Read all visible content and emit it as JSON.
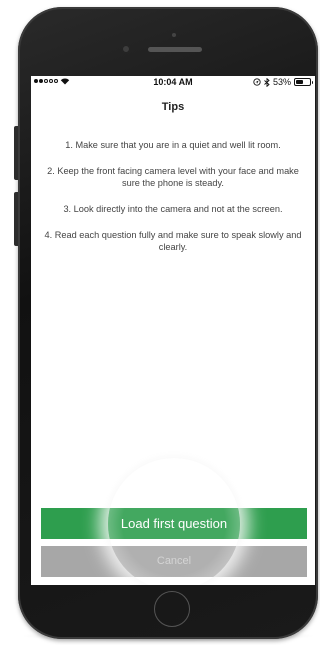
{
  "status_bar": {
    "time": "10:04 AM",
    "battery_percent": "53%",
    "battery_level": 0.53,
    "signal_bars": 2,
    "icons": [
      "signal-dots-icon",
      "wifi-icon",
      "location-icon",
      "bluetooth-icon",
      "battery-icon"
    ]
  },
  "page": {
    "title": "Tips"
  },
  "tips": [
    "1. Make sure that you are in a quiet and well lit room.",
    "2. Keep the front facing camera level with your face and make sure the phone is steady.",
    "3. Look directly into the camera and not at the screen.",
    "4. Read each question fully and make sure to speak slowly and clearly."
  ],
  "actions": {
    "primary_label": "Load first question",
    "secondary_label": "Cancel"
  },
  "colors": {
    "primary": "#2e9e4e",
    "secondary": "#a7a7a7"
  }
}
